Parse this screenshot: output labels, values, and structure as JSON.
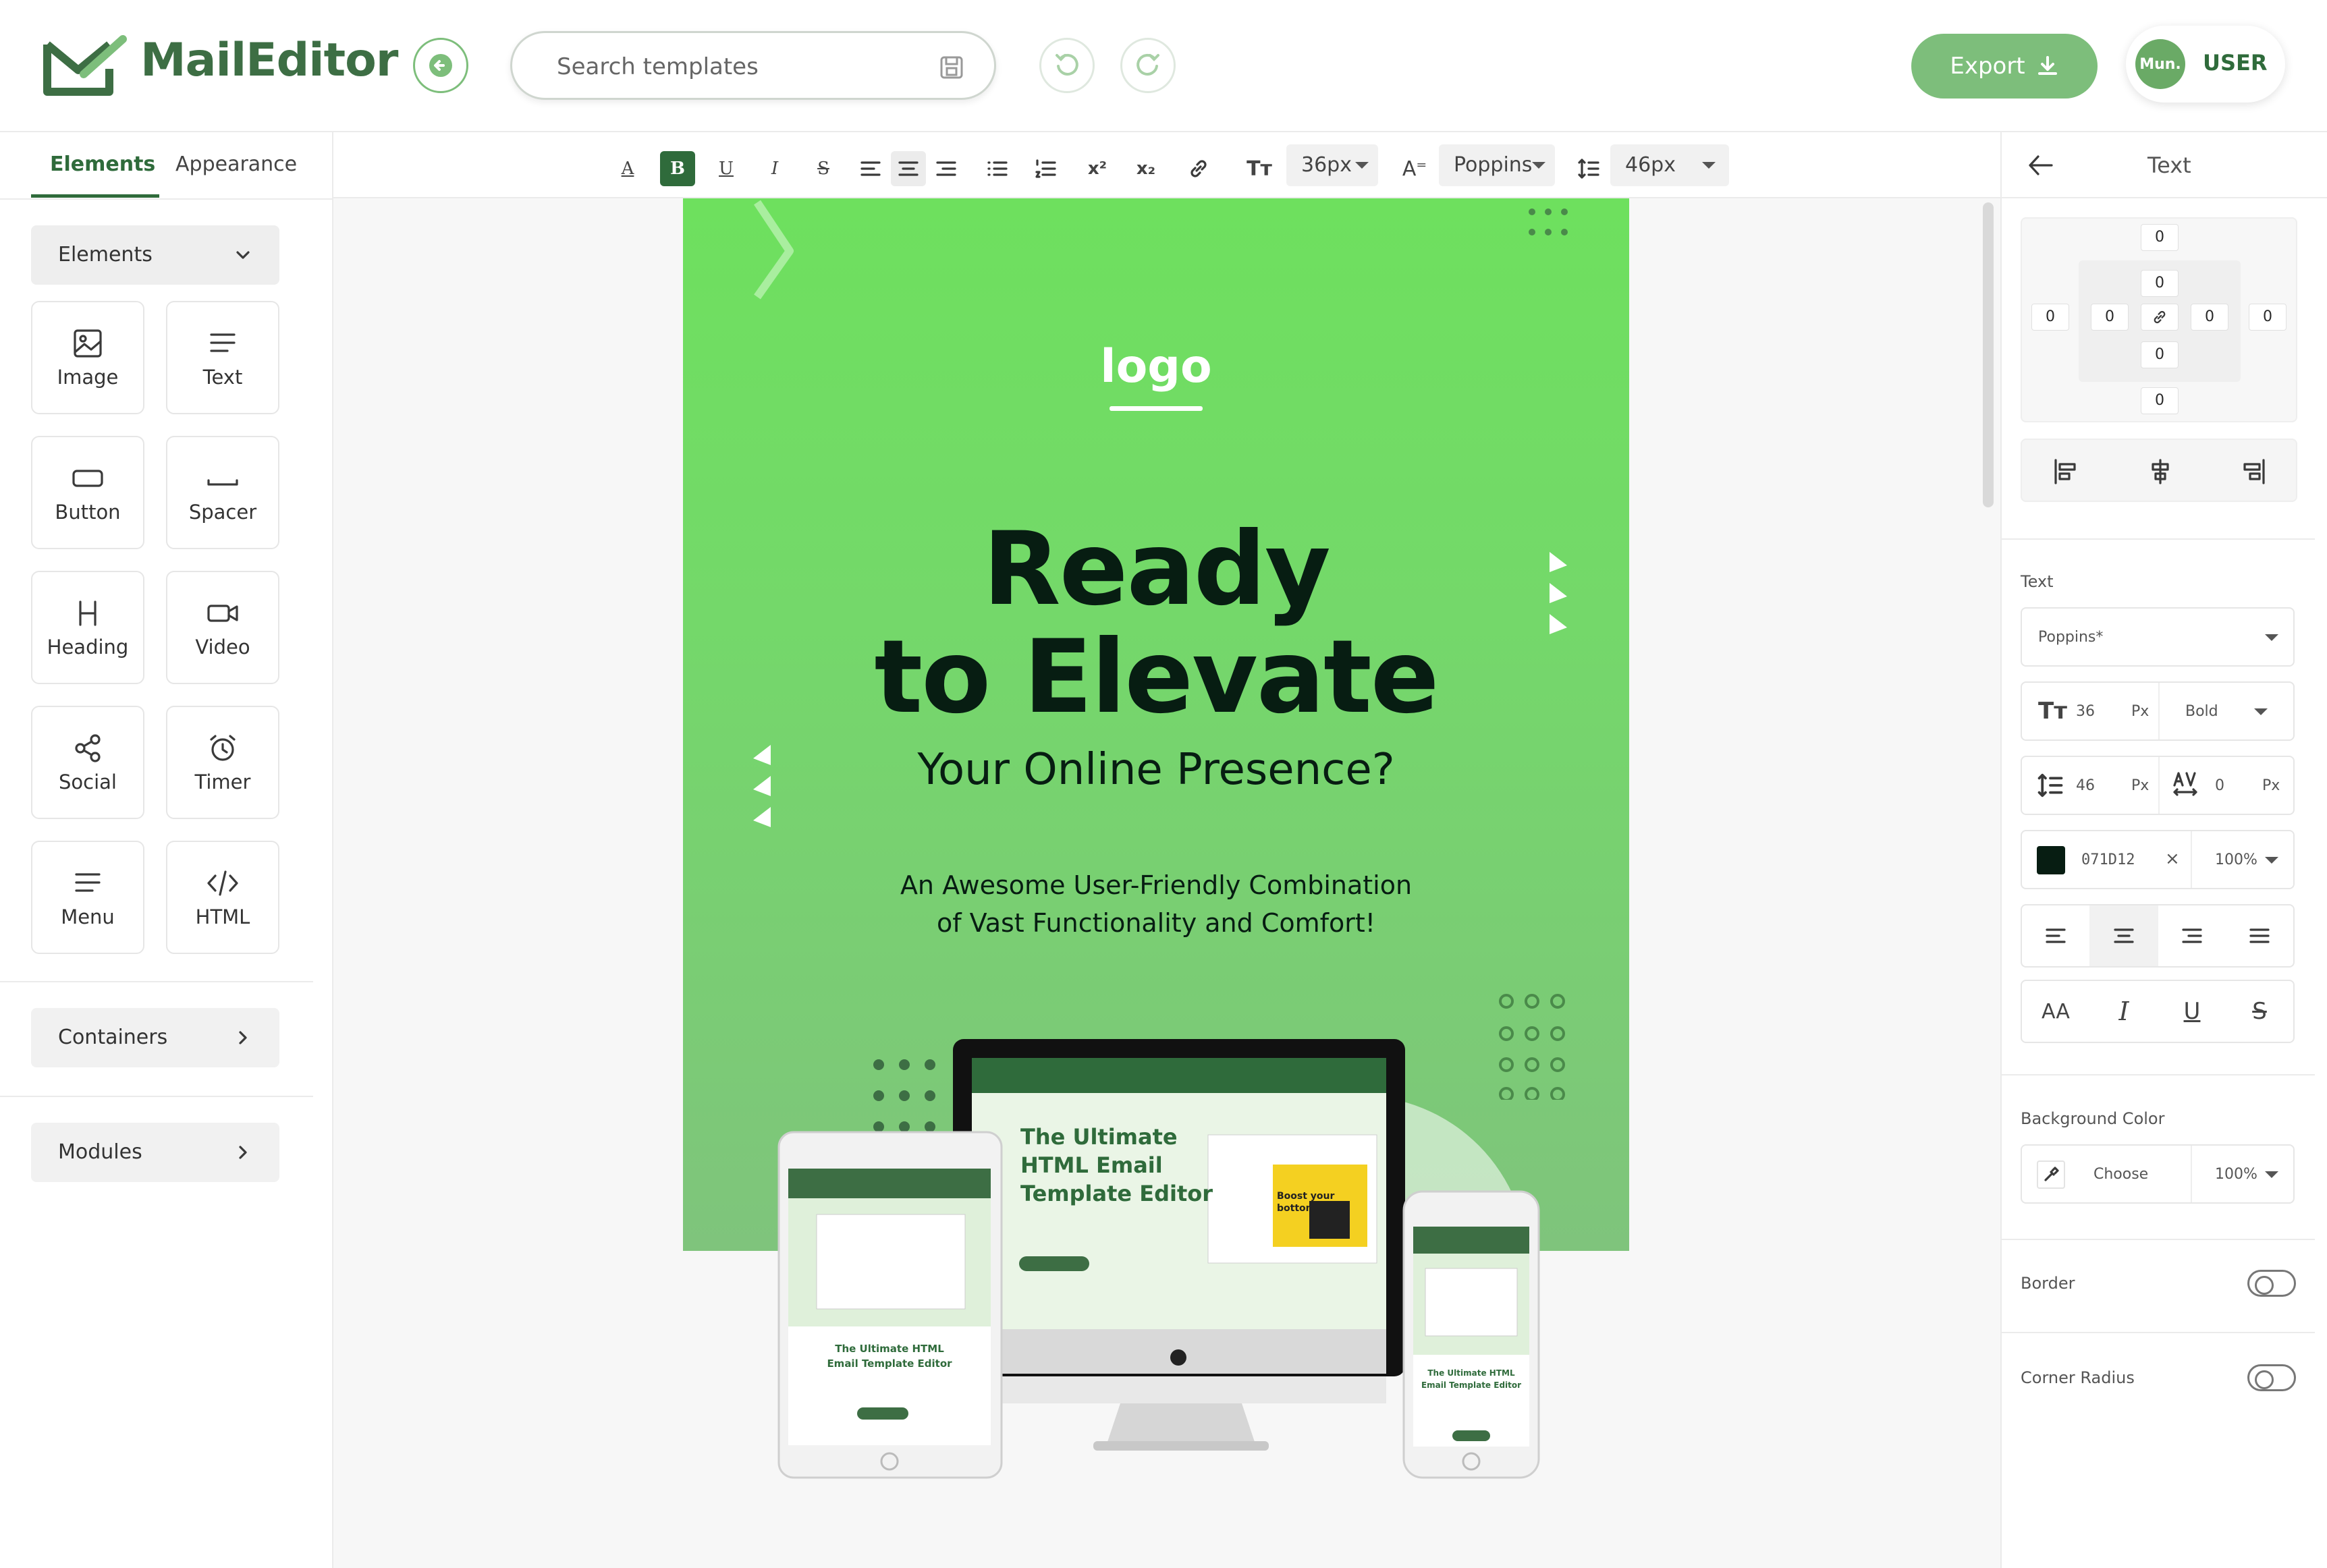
{
  "app": {
    "name": "MailEditor"
  },
  "header": {
    "search_placeholder": "Search templates",
    "export_label": "Export",
    "user_initials": "Mun.",
    "user_label": "USER"
  },
  "left": {
    "tabs": [
      {
        "label": "Elements",
        "active": true
      },
      {
        "label": "Appearance",
        "active": false
      }
    ],
    "dropdown_label": "Elements",
    "elements": [
      {
        "label": "Image",
        "icon": "image-icon"
      },
      {
        "label": "Text",
        "icon": "text-icon"
      },
      {
        "label": "Button",
        "icon": "button-icon"
      },
      {
        "label": "Spacer",
        "icon": "spacer-icon"
      },
      {
        "label": "Heading",
        "icon": "heading-icon"
      },
      {
        "label": "Video",
        "icon": "video-icon"
      },
      {
        "label": "Social",
        "icon": "share-icon"
      },
      {
        "label": "Timer",
        "icon": "alarm-icon"
      },
      {
        "label": "Menu",
        "icon": "menu-icon"
      },
      {
        "label": "HTML",
        "icon": "code-icon"
      }
    ],
    "containers_label": "Containers",
    "modules_label": "Modules"
  },
  "toolbar": {
    "font_size": "36px",
    "font_family": "Poppins",
    "line_height": "46px",
    "superscript": "x²",
    "subscript": "x₂"
  },
  "email": {
    "logo": "logo",
    "title_line1": "Ready",
    "title_line2": "to Elevate",
    "subtitle": "Your Online Presence?",
    "body_line1": "An Awesome User-Friendly Combination",
    "body_line2": "of Vast Functionality and Comfort!",
    "mock_heading_1": "The Ultimate",
    "mock_heading_2": "HTML Email",
    "mock_heading_3": "Template Editor",
    "mock_small_1": "The Ultimate HTML",
    "mock_small_2": "Email Template Editor",
    "mock_boost_1": "Boost your",
    "mock_boost_2": "bottom line."
  },
  "right": {
    "title": "Text",
    "spacing_values": {
      "margin_top": "0",
      "padding_top": "0",
      "margin_left": "0",
      "padding_left": "0",
      "padding_right": "0",
      "margin_right": "0",
      "padding_bottom": "0",
      "margin_bottom": "0"
    },
    "text_section_label": "Text",
    "font_family": "Poppins*",
    "font_size": "36",
    "font_size_unit": "Px",
    "font_weight": "Bold",
    "line_height": "46",
    "line_height_unit": "Px",
    "letter_spacing": "0",
    "letter_spacing_unit": "Px",
    "color_hex": "071D12",
    "color_swatch": "#071d12",
    "opacity": "100%",
    "bg_label": "Background Color",
    "bg_choose": "Choose",
    "bg_opacity": "100%",
    "border_label": "Border",
    "corner_label": "Corner Radius",
    "case_label": "AA"
  },
  "colors": {
    "brand": "#3d6e44",
    "accent": "#7dbe7b",
    "email_green": "#6ee05e",
    "text_dark": "#071d12"
  }
}
